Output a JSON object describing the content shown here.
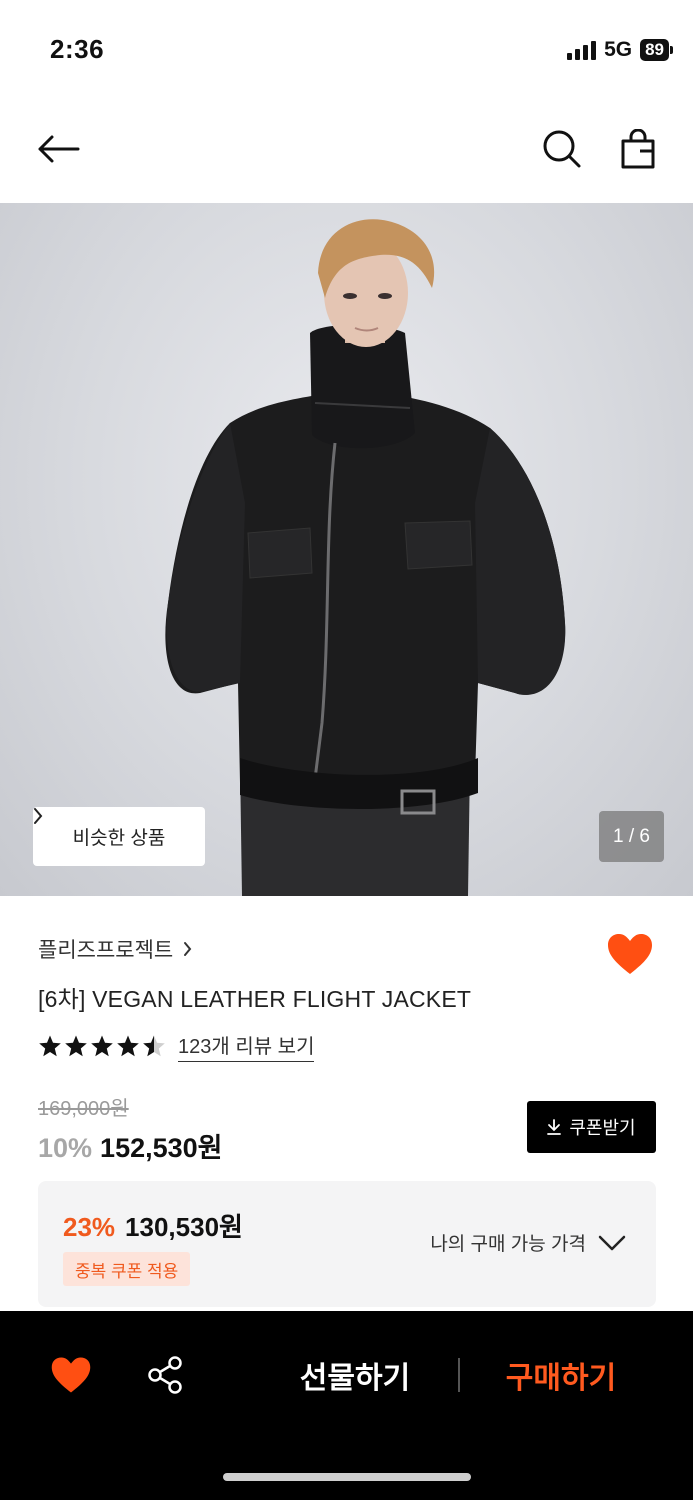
{
  "status_bar": {
    "time": "2:36",
    "network": "5G",
    "battery": "89"
  },
  "header": {
    "back_icon": "arrow-left-icon",
    "search_icon": "search-icon",
    "bag_icon": "shopping-bag-icon"
  },
  "hero": {
    "similar_label": "비슷한 상품",
    "page_indicator": "1 / 6",
    "image_alt": "product-photo"
  },
  "product": {
    "brand": "플리즈프로젝트",
    "title": "[6차] VEGAN LEATHER FLIGHT JACKET",
    "rating": 4.5,
    "review_link": "123개 리뷰 보기",
    "original_price": "169,000원",
    "discount": "10%",
    "price": "152,530원",
    "coupon_button": "쿠폰받기"
  },
  "best_price": {
    "discount": "23%",
    "price": "130,530원",
    "badge": "중복 쿠폰 적용",
    "toggle_label": "나의 구매 가능 가격"
  },
  "bottom_bar": {
    "gift_label": "선물하기",
    "buy_label": "구매하기"
  },
  "colors": {
    "accent": "#ff5a1f",
    "like": "#ff4f12",
    "bar": "#000000"
  }
}
